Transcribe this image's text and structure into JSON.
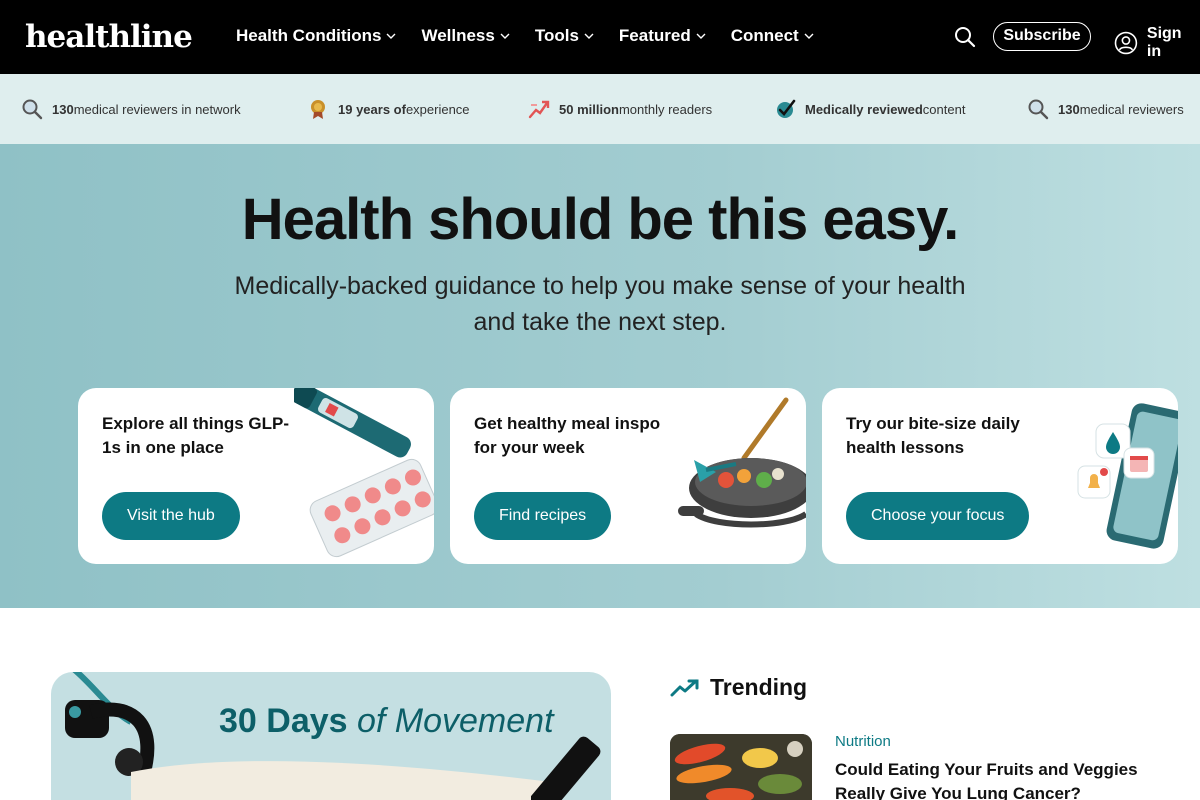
{
  "brand": {
    "logo": "healthline"
  },
  "nav": {
    "items": [
      {
        "label": "Health Conditions"
      },
      {
        "label": "Wellness"
      },
      {
        "label": "Tools"
      },
      {
        "label": "Featured"
      },
      {
        "label": "Connect"
      }
    ],
    "subscribe_label": "Subscribe",
    "signin_label": "Sign in"
  },
  "stats": [
    {
      "bold": "130",
      "rest": " medical reviewers in network",
      "icon": "magnifier-icon"
    },
    {
      "bold": "19 years of",
      "rest": " experience",
      "icon": "medal-icon"
    },
    {
      "bold": "50 million",
      "rest": " monthly readers",
      "icon": "trend-arrow-icon"
    },
    {
      "bold": "Medically reviewed",
      "rest": " content",
      "icon": "checkmark-badge-icon"
    },
    {
      "bold": "130",
      "rest": " medical reviewers",
      "icon": "magnifier-icon"
    }
  ],
  "hero": {
    "title": "Health should be this easy.",
    "subtitle": "Medically-backed guidance to help you make sense of your health and take the next step."
  },
  "cards": [
    {
      "title": "Explore all things GLP-1s in one place",
      "button": "Visit the hub"
    },
    {
      "title": "Get healthy meal inspo for your week",
      "button": "Find recipes"
    },
    {
      "title": "Try our bite-size daily health lessons",
      "button": "Choose your focus"
    }
  ],
  "feature": {
    "title_bold": "30 Days",
    "title_italic": " of Movement"
  },
  "trending": {
    "heading": "Trending",
    "items": [
      {
        "category": "Nutrition",
        "title": "Could Eating Your Fruits and Veggies Really Give You Lung Cancer?"
      }
    ]
  },
  "colors": {
    "accent": "#0d7a84",
    "nav_bg": "#000000",
    "strip_bg": "#dfeeee"
  }
}
